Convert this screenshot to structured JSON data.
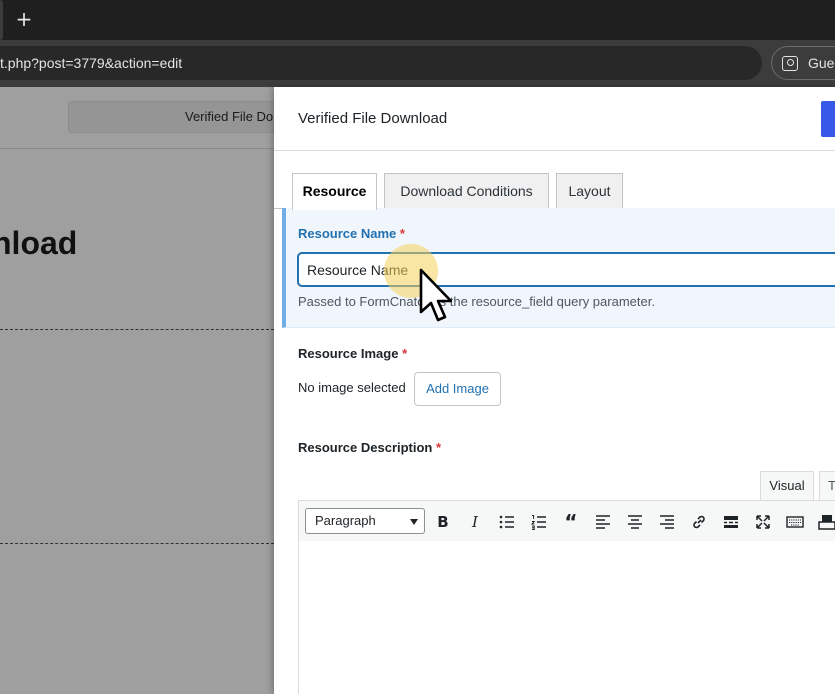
{
  "browser": {
    "new_tab_glyph": "+",
    "url": "t.php?post=3779&action=edit",
    "profile_label": "Guest",
    "profile_icon": "person-icon"
  },
  "background_page": {
    "button_label": "Verified File Do",
    "heading": "nload"
  },
  "panel": {
    "title": "Verified File Download",
    "tabs": [
      {
        "label": "Resource",
        "active": true
      },
      {
        "label": "Download Conditions",
        "active": false
      },
      {
        "label": "Layout",
        "active": false
      }
    ],
    "resource_name": {
      "label": "Resource Name",
      "required_mark": "*",
      "value": "Resource Name",
      "help": "Passed to FormCnator as the resource_field query parameter."
    },
    "resource_image": {
      "label": "Resource Image",
      "required_mark": "*",
      "status": "No image selected",
      "button": "Add Image"
    },
    "resource_description": {
      "label": "Resource Description",
      "required_mark": "*",
      "editor_tabs": [
        "Visual",
        "T"
      ],
      "format_value": "Paragraph"
    }
  },
  "colors": {
    "accent": "#2271b1",
    "primary_button": "#3858e9",
    "required": "#d63638",
    "cursor_highlight": "#f6d25a"
  }
}
